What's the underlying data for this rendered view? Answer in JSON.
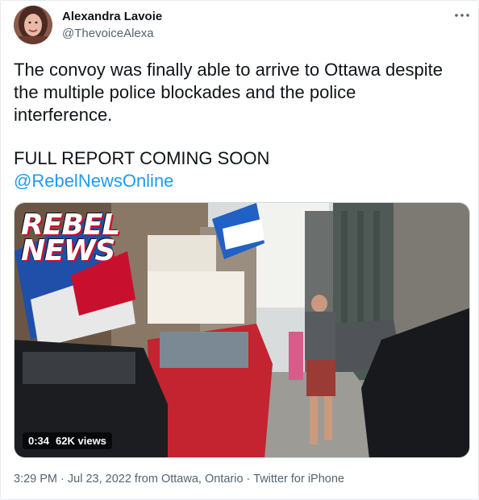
{
  "author": {
    "name": "Alexandra Lavoie",
    "handle": "@ThevoiceAlexa"
  },
  "tweet": {
    "lines": [
      "The convoy was finally able to arrive to Ottawa despite",
      "the multiple police blockades and the police",
      "interference."
    ],
    "report_line": "FULL REPORT COMING SOON",
    "mention": "@RebelNewsOnline"
  },
  "media": {
    "logo_line1": "REBEL",
    "logo_line2": "NEWS",
    "duration": "0:34",
    "views": "62K views"
  },
  "footer": {
    "time": "3:29 PM",
    "sep1": " · ",
    "date": "Jul 23, 2022",
    "from": " from ",
    "location": "Ottawa, Ontario",
    "sep2": " · ",
    "client": "Twitter for iPhone"
  },
  "colors": {
    "text": "#0f1419",
    "secondary": "#536471",
    "link": "#1d9bf0"
  },
  "icons": {
    "more": "more-horizontal-icon"
  }
}
